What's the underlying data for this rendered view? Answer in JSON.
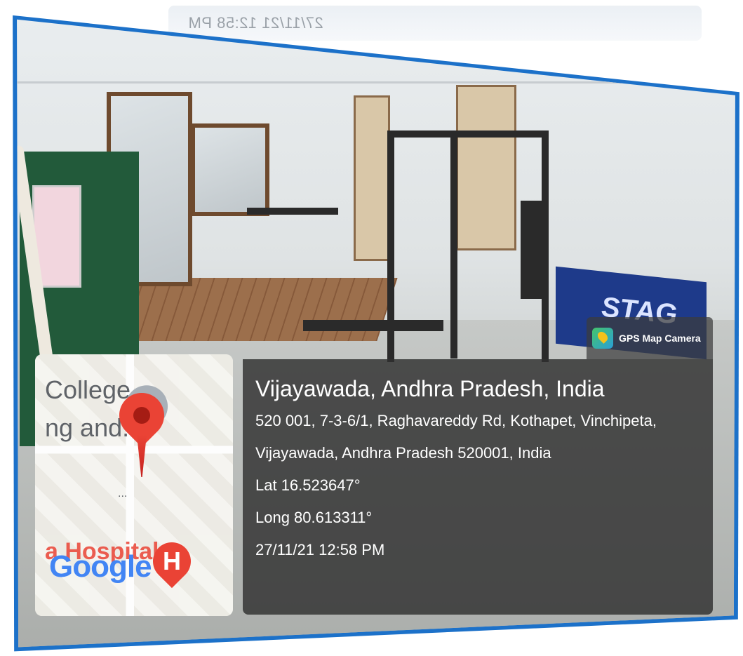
{
  "reflection": {
    "timestamp": "27/11/21 12:58 PM"
  },
  "scene": {
    "banner_text": "STAG"
  },
  "gps_badge": {
    "label": "GPS Map Camera",
    "icon": "gps-map-camera-app-icon"
  },
  "info": {
    "title": "Vijayawada, Andhra Pradesh, India",
    "address_line1": "520 001, 7-3-6/1, Raghavareddy Rd, Kothapet, Vinchipeta,",
    "address_line2": "Vijayawada, Andhra Pradesh 520001, India",
    "lat": "Lat 16.523647°",
    "long": "Long 80.613311°",
    "datetime": "27/11/21 12:58 PM"
  },
  "map": {
    "label_line1": "College",
    "label_line2": "ng and..",
    "ellipsis": "...",
    "hospital_label": "a Hospital",
    "logo_text": "Google",
    "hospital_marker": "H"
  },
  "colors": {
    "frame": "#1c71c9",
    "panel": "#303030",
    "pin": "#ea4335"
  }
}
